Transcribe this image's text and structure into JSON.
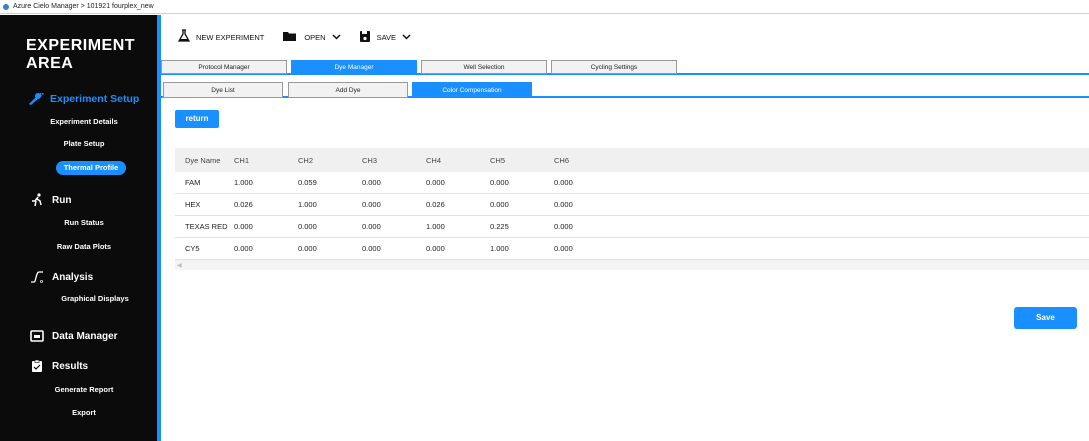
{
  "window": {
    "title": "Azure Cielo Manager > 101921 fourplex_new"
  },
  "sidebar": {
    "area_title_line1": "EXPERIMENT",
    "area_title_line2": "AREA",
    "sections": {
      "experiment_setup": {
        "label": "Experiment Setup",
        "icon": "wrench-icon"
      },
      "run": {
        "label": "Run",
        "icon": "runner-icon"
      },
      "analysis": {
        "label": "Analysis",
        "icon": "curve-icon"
      },
      "data_manager": {
        "label": "Data Manager",
        "icon": "folder-icon"
      },
      "results": {
        "label": "Results",
        "icon": "clipboard-icon"
      }
    },
    "items": {
      "experiment_details": "Experiment Details",
      "plate_setup": "Plate Setup",
      "thermal_profile": "Thermal Profile",
      "run_status": "Run Status",
      "raw_data_plots": "Raw Data Plots",
      "graphical_displays": "Graphical Displays",
      "generate_report": "Generate Report",
      "export": "Export"
    }
  },
  "toolbar": {
    "new_experiment": "NEW EXPERIMENT",
    "open": "OPEN",
    "save": "SAVE"
  },
  "tabs": {
    "protocol_manager": "Protocol Manager",
    "dye_manager": "Dye Manager",
    "well_selection": "Well Selection",
    "cycling_settings": "Cycling Settings"
  },
  "subtabs": {
    "dye_list": "Dye List",
    "add_dye": "Add Dye",
    "color_compensation": "Color Compensation"
  },
  "return_label": "return",
  "save_label": "Save",
  "table": {
    "headers": [
      "Dye Name",
      "CH1",
      "CH2",
      "CH3",
      "CH4",
      "CH5",
      "CH6"
    ],
    "rows": [
      [
        "FAM",
        "1.000",
        "0.059",
        "0.000",
        "0.000",
        "0.000",
        "0.000"
      ],
      [
        "HEX",
        "0.026",
        "1.000",
        "0.000",
        "0.026",
        "0.000",
        "0.000"
      ],
      [
        "TEXAS RED",
        "0.000",
        "0.000",
        "0.000",
        "1.000",
        "0.225",
        "0.000"
      ],
      [
        "CY5",
        "0.000",
        "0.000",
        "0.000",
        "0.000",
        "1.000",
        "0.000"
      ]
    ]
  },
  "colors": {
    "accent": "#1a8fff",
    "sidebar_bg": "#0b0b0b"
  }
}
